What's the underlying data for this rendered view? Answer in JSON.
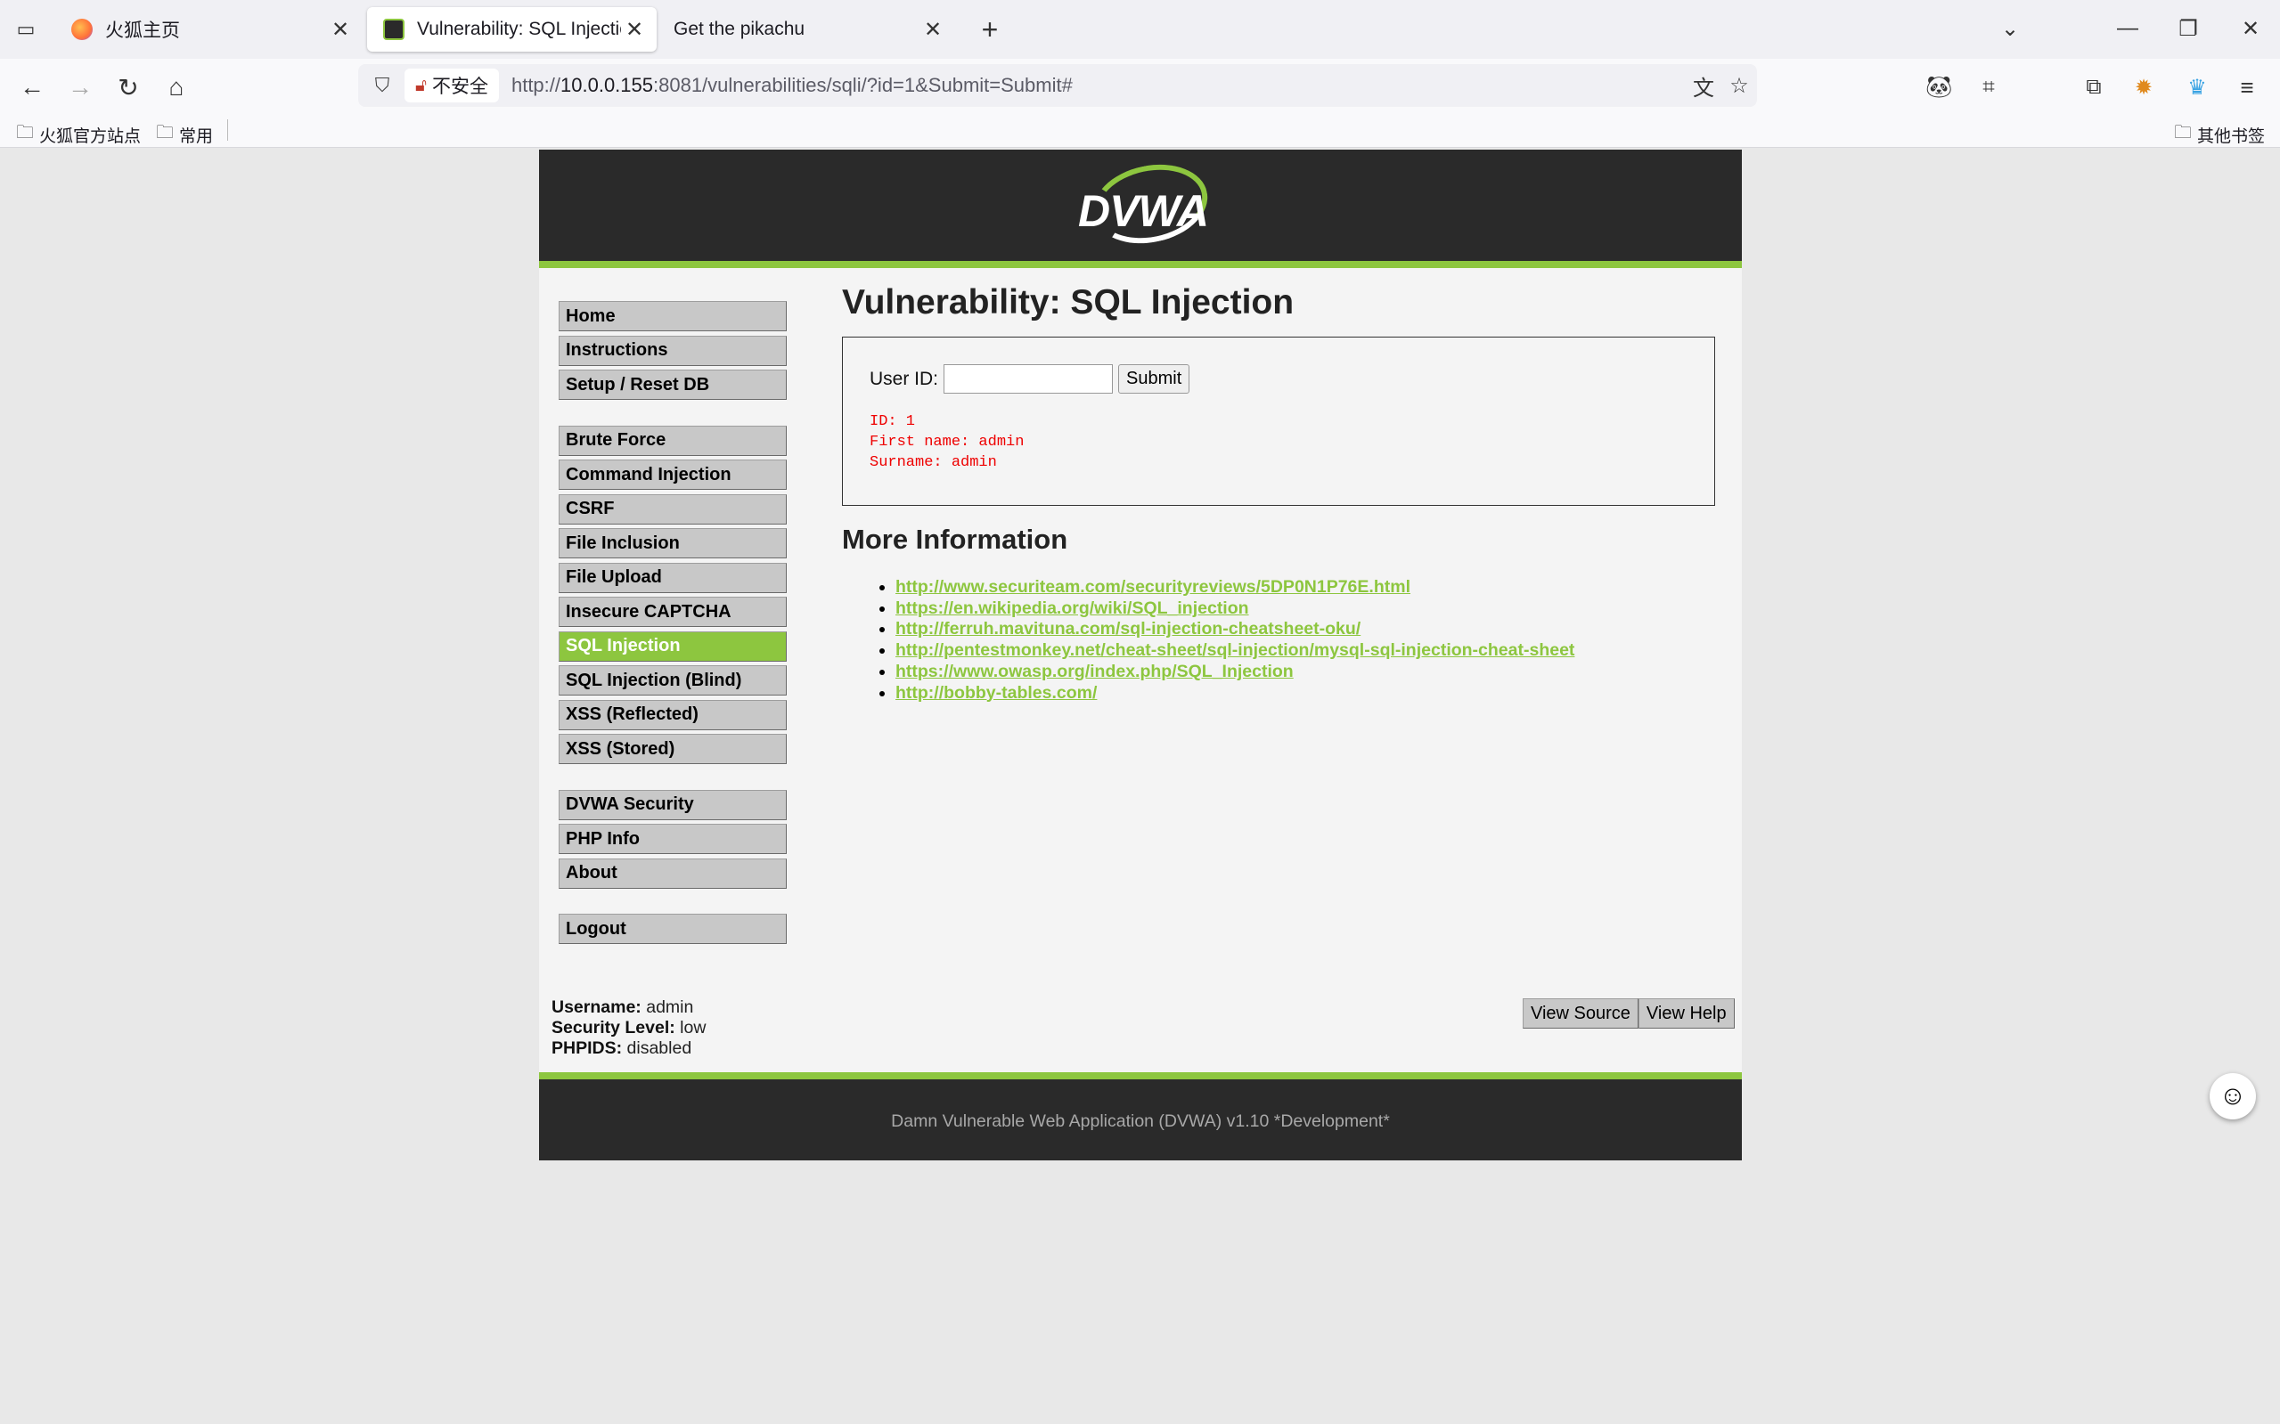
{
  "browser": {
    "tabs": [
      {
        "title": "火狐主页",
        "active": false
      },
      {
        "title": "Vulnerability: SQL Injection ::",
        "active": true
      },
      {
        "title": "Get the pikachu",
        "active": false
      }
    ],
    "url_prefix": "http://",
    "url_host": "10.0.0.155",
    "url_rest": ":8081/vulnerabilities/sqli/?id=1&Submit=Submit#",
    "insecure_label": "不安全",
    "bookmarks": [
      "火狐官方站点",
      "常用"
    ],
    "other_bookmarks": "其他书签"
  },
  "dvwa": {
    "logo_text": "DVWA",
    "menu": {
      "group1": [
        "Home",
        "Instructions",
        "Setup / Reset DB"
      ],
      "group2": [
        "Brute Force",
        "Command Injection",
        "CSRF",
        "File Inclusion",
        "File Upload",
        "Insecure CAPTCHA",
        "SQL Injection",
        "SQL Injection (Blind)",
        "XSS (Reflected)",
        "XSS (Stored)"
      ],
      "group3": [
        "DVWA Security",
        "PHP Info",
        "About"
      ],
      "group4": [
        "Logout"
      ],
      "selected": "SQL Injection"
    },
    "page_title": "Vulnerability: SQL Injection",
    "form": {
      "label": "User ID:",
      "value": "",
      "submit_label": "Submit"
    },
    "result": {
      "id_line": "ID: 1",
      "first_name_line": "First name: admin",
      "surname_line": "Surname: admin"
    },
    "more_info_title": "More Information",
    "links": [
      "http://www.securiteam.com/securityreviews/5DP0N1P76E.html",
      "https://en.wikipedia.org/wiki/SQL_injection",
      "http://ferruh.mavituna.com/sql-injection-cheatsheet-oku/",
      "http://pentestmonkey.net/cheat-sheet/sql-injection/mysql-sql-injection-cheat-sheet",
      "https://www.owasp.org/index.php/SQL_Injection",
      "http://bobby-tables.com/"
    ],
    "user": {
      "username_label": "Username:",
      "username": "admin",
      "security_label": "Security Level:",
      "security": "low",
      "phpids_label": "PHPIDS:",
      "phpids": "disabled"
    },
    "view_source": "View Source",
    "view_help": "View Help",
    "footer": "Damn Vulnerable Web Application (DVWA) v1.10 *Development*"
  },
  "colors": {
    "accent": "#8dc63f",
    "header_bg": "#2a2a2a",
    "result_text": "#ff0000"
  }
}
